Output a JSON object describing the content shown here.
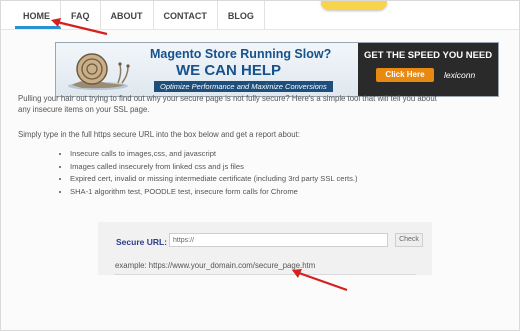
{
  "nav": {
    "items": [
      {
        "label": "HOME",
        "active": true
      },
      {
        "label": "FAQ"
      },
      {
        "label": "ABOUT"
      },
      {
        "label": "CONTACT"
      },
      {
        "label": "BLOG"
      }
    ]
  },
  "banner": {
    "headline": "Magento Store Running Slow?",
    "subhead": "WE CAN HELP",
    "tagline": "Optimize Performance and Maximize Conversions",
    "cta_title": "GET THE SPEED YOU NEED",
    "cta_button": "Click Here",
    "brand": "lexiconn"
  },
  "main": {
    "intro_line1": "Pulling your hair out trying to find out why your secure page is not fully secure? Here's a simple tool that will tell you about",
    "intro_line2": "any insecure items on your SSL page.",
    "simply": "Simply type in the full https secure URL into the box below and get a report about:",
    "bullets": [
      "Insecure calls to images,css, and javascript",
      "Images called insecurely from linked css and js files",
      "Expired cert, invalid or missing intermediate certificate (including 3rd party SSL certs.)",
      "SHA-1 algorithm test, POODLE test, insecure form calls for Chrome"
    ]
  },
  "form": {
    "label": "Secure URL:",
    "value": "https://",
    "button": "Check",
    "example": "example: https://www.your_domain.com/secure_page.htm"
  },
  "colors": {
    "accent": "#2b8fd6",
    "annotation_arrow": "#d62020",
    "label_blue": "#2b3e8c"
  }
}
